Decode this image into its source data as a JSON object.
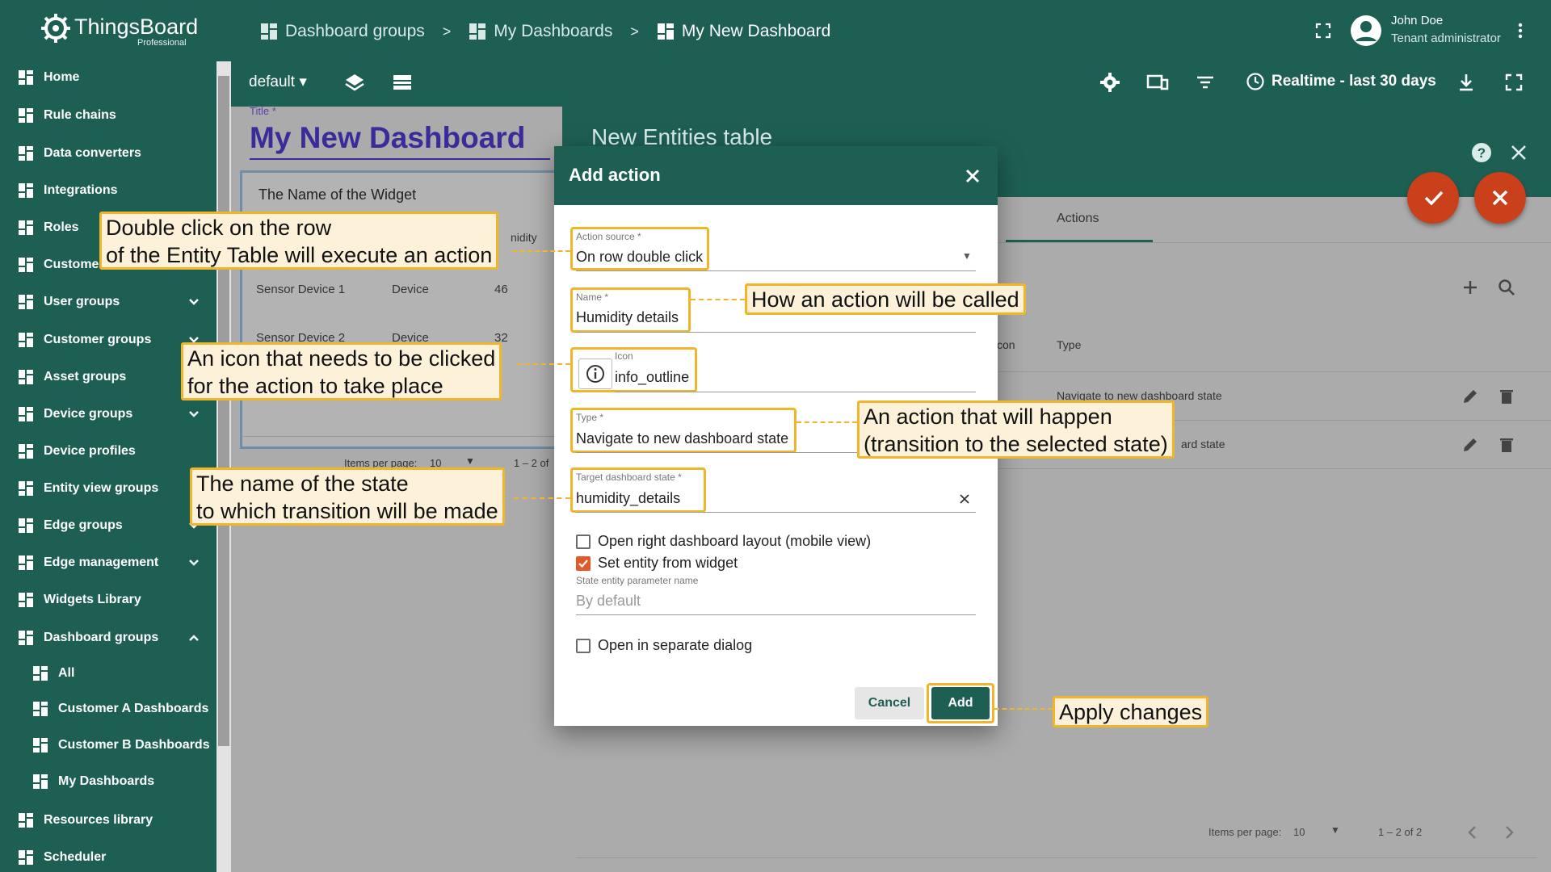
{
  "app": {
    "logo_text": "ThingsBoard",
    "logo_sub": "Professional"
  },
  "breadcrumbs": [
    "Dashboard groups",
    "My Dashboards",
    "My New Dashboard"
  ],
  "breadcrumb_separator": ">",
  "user": {
    "name": "John Doe",
    "role": "Tenant administrator"
  },
  "sidebar": {
    "items": [
      {
        "label": "Home",
        "icon": "home-icon"
      },
      {
        "label": "Rule chains",
        "icon": "rule-chain-icon"
      },
      {
        "label": "Data converters",
        "icon": "converter-icon"
      },
      {
        "label": "Integrations",
        "icon": "integration-icon"
      },
      {
        "label": "Roles",
        "icon": "shield-icon"
      },
      {
        "label": "Customer",
        "icon": "customer-icon"
      },
      {
        "label": "User groups",
        "icon": "user-icon"
      },
      {
        "label": "Customer groups",
        "icon": "people-icon"
      },
      {
        "label": "Asset groups",
        "icon": "building-icon"
      },
      {
        "label": "Device groups",
        "icon": "devices-icon"
      },
      {
        "label": "Device profiles",
        "icon": "device-profile-icon"
      },
      {
        "label": "Entity view groups",
        "icon": "view-icon"
      },
      {
        "label": "Edge groups",
        "icon": "edge-icon"
      },
      {
        "label": "Edge management",
        "icon": "router-icon"
      },
      {
        "label": "Widgets Library",
        "icon": "widgets-icon"
      },
      {
        "label": "Dashboard groups",
        "icon": "dashboard-icon"
      },
      {
        "label": "All",
        "icon": "dashboard-icon"
      },
      {
        "label": "Customer A Dashboards",
        "icon": "dashboard-icon"
      },
      {
        "label": "Customer B Dashboards",
        "icon": "dashboard-icon"
      },
      {
        "label": "My Dashboards",
        "icon": "dashboard-icon"
      },
      {
        "label": "Resources library",
        "icon": "folder-icon"
      },
      {
        "label": "Scheduler",
        "icon": "clock-icon"
      }
    ]
  },
  "toolbar": {
    "state": "default",
    "realtime": "Realtime - last 30 days"
  },
  "dashboard": {
    "title_label": "Title *",
    "title": "My New Dashboard",
    "widget_title": "The Name of the Widget",
    "col_humidity": "nidity",
    "rows": [
      {
        "name": "Sensor Device 1",
        "type": "Device",
        "value": "46"
      },
      {
        "name": "Sensor Device 2",
        "type": "Device",
        "value": "32"
      }
    ],
    "items_per_page": "Items per page:",
    "items_per_page_value": "10",
    "range": "1 – 2 of"
  },
  "right_panel": {
    "title": "New Entities table",
    "tab": "Actions",
    "col_icon": "con",
    "col_type": "Type",
    "rows": [
      "Navigate to new dashboard state",
      "ard state"
    ],
    "items_per_page": "Items per page:",
    "items_per_page_value": "10",
    "range": "1 – 2 of 2"
  },
  "dialog": {
    "title": "Add action",
    "action_source_label": "Action source *",
    "action_source": "On row double click",
    "name_label": "Name *",
    "name": "Humidity details",
    "icon_label": "Icon",
    "icon": "info_outline",
    "type_label": "Type *",
    "type": "Navigate to new dashboard state",
    "target_label": "Target dashboard state *",
    "target": "humidity_details",
    "cb_open_right": "Open right dashboard layout (mobile view)",
    "cb_set_entity": "Set entity from widget",
    "state_param_label": "State entity parameter name",
    "state_param_placeholder": "By default",
    "cb_separate_dialog": "Open in separate dialog",
    "cancel": "Cancel",
    "add": "Add"
  },
  "callouts": {
    "double_click_1": "Double click on the row",
    "double_click_2": "of the Entity Table will execute an action",
    "name_called": "How an action will be called",
    "icon_1": "An icon that needs to be clicked",
    "icon_2": "for the action to take place",
    "type_1": "An action that will happen",
    "type_2": "(transition to the selected state)",
    "state_1": "The name of the state",
    "state_2": "to which transition will be made",
    "apply": "Apply changes"
  },
  "colors": {
    "primary": "#1e5f54",
    "accent": "#c9401a",
    "highlight": "#f0b52b",
    "callout_bg": "#fdf2d9"
  }
}
